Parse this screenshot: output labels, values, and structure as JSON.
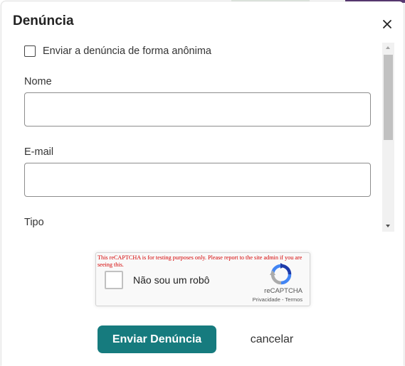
{
  "dialog": {
    "title": "Denúncia"
  },
  "form": {
    "anonymous_label": "Enviar a denúncia de forma anônima",
    "anonymous_checked": false,
    "name_label": "Nome",
    "name_value": "",
    "email_label": "E-mail",
    "email_value": "",
    "type_label": "Tipo"
  },
  "recaptcha": {
    "warning": "This reCAPTCHA is for testing purposes only. Please report to the site admin if you are seeing this.",
    "checkbox_label": "Não sou um robô",
    "brand": "reCAPTCHA",
    "privacy_link": "Privacidade",
    "separator": " - ",
    "terms_link": "Termos"
  },
  "actions": {
    "submit_label": "Enviar Denúncia",
    "cancel_label": "cancelar"
  },
  "colors": {
    "accent": "#167b7e",
    "warning_text": "#d40000"
  },
  "icons": {
    "close": "close-icon",
    "recaptcha": "recaptcha-logo-icon"
  }
}
